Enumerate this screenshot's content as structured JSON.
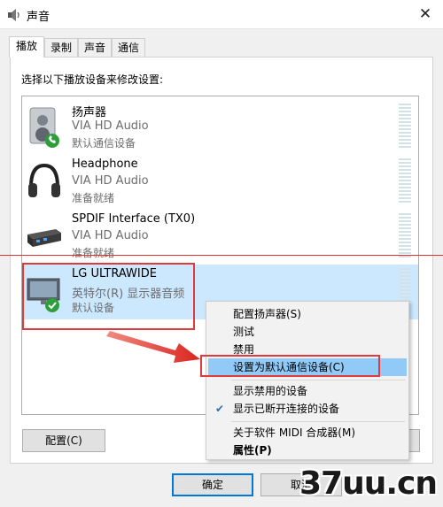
{
  "window": {
    "title": "声音",
    "close": "✕"
  },
  "tabs": [
    {
      "label": "播放",
      "active": true
    },
    {
      "label": "录制",
      "active": false
    },
    {
      "label": "声音",
      "active": false
    },
    {
      "label": "通信",
      "active": false
    }
  ],
  "instruction": "选择以下播放设备来修改设置:",
  "devices": [
    {
      "name": "扬声器",
      "driver": "VIA HD Audio",
      "status": "默认通信设备",
      "icon": "speaker-icon",
      "badge": "phone-badge",
      "selected": false
    },
    {
      "name": "Headphone",
      "driver": "VIA HD Audio",
      "status": "准备就绪",
      "icon": "headphone-icon",
      "badge": "",
      "selected": false
    },
    {
      "name": "SPDIF Interface (TX0)",
      "driver": "VIA HD Audio",
      "status": "准备就绪",
      "icon": "spdif-device-icon",
      "badge": "",
      "selected": false
    },
    {
      "name": "LG ULTRAWIDE",
      "driver": "英特尔(R) 显示器音频",
      "status": "默认设备",
      "icon": "monitor-icon",
      "badge": "default-check-badge",
      "selected": true
    }
  ],
  "buttons": {
    "configure": "配置(C)",
    "ok": "确定",
    "cancel": "取消"
  },
  "context_menu": {
    "items": [
      {
        "label": "配置扬声器(S)"
      },
      {
        "label": "测试"
      },
      {
        "label": "禁用"
      },
      {
        "label": "设置为默认通信设备(C)",
        "highlighted": true
      },
      {
        "label": "显示禁用的设备"
      },
      {
        "label": "显示已断开连接的设备",
        "checked": true
      },
      {
        "label": "关于软件 MIDI 合成器(M)"
      },
      {
        "label": "属性(P)",
        "bold": true
      }
    ]
  },
  "watermark": "37uu.cn",
  "colors": {
    "selection": "#cce8ff",
    "menu_highlight": "#91c9f7",
    "annotation_red": "#e03a3a",
    "accent": "#0078d7"
  }
}
